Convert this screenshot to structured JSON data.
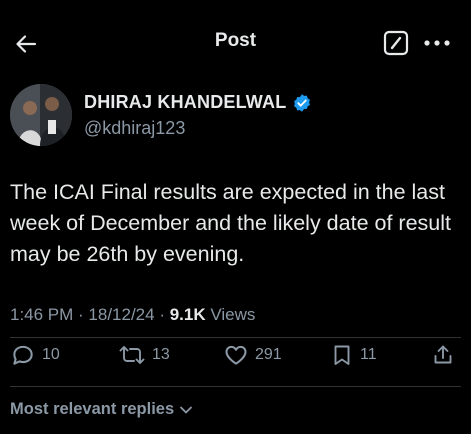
{
  "header": {
    "title": "Post",
    "back_icon": "arrow-left-icon",
    "edit_icon": "compose-icon",
    "more_icon": "more-horizontal-icon"
  },
  "author": {
    "name": "DHIRAJ KHANDELWAL",
    "handle": "@kdhiraj123",
    "verified": true,
    "verified_color": "#1d9bf0"
  },
  "tweet": {
    "text": "The ICAI Final results are expected in the last week of December and the likely date of result may be 26th by evening.",
    "time": "1:46 PM",
    "separator1": " · ",
    "date": "18/12/24",
    "separator2": " · ",
    "views_count": "9.1K",
    "views_label": " Views"
  },
  "actions": {
    "replies": "10",
    "reposts": "13",
    "likes": "291",
    "bookmarks": "11"
  },
  "replies_filter": {
    "label": "Most relevant replies"
  },
  "colors": {
    "background": "#000000",
    "text_primary": "#e7e9ea",
    "text_secondary": "#8b98a5",
    "divider": "#2f3336"
  }
}
